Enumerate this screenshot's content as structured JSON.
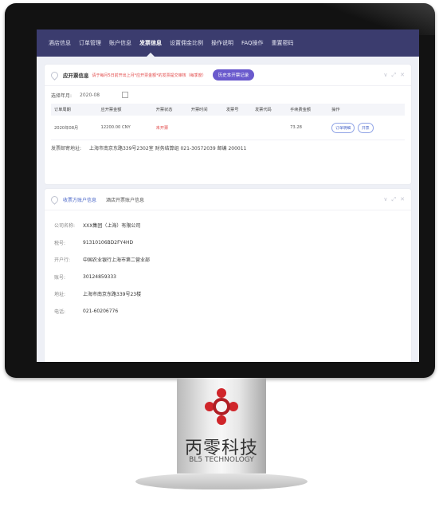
{
  "nav": {
    "items": [
      {
        "label": "酒店信息",
        "active": false
      },
      {
        "label": "订单管理",
        "active": false
      },
      {
        "label": "账户信息",
        "active": false
      },
      {
        "label": "发票信息",
        "active": true
      },
      {
        "label": "设置佣金比例",
        "active": false
      },
      {
        "label": "操作说明",
        "active": false
      },
      {
        "label": "FAQ操作",
        "active": false
      },
      {
        "label": "重置密码",
        "active": false
      }
    ]
  },
  "invoice_card": {
    "title": "应开票信息",
    "tip": "请于每月5日前开出上月*应开票金额*的发票提交审核（每季度）",
    "history_button": "历史本开票记录",
    "filter_label": "选择年月:",
    "filter_value": "2020-08",
    "columns": [
      "订单周期",
      "应开票金额",
      "开票状态",
      "开票时间",
      "发票号",
      "发票代码",
      "手续费金额",
      "操作"
    ],
    "rows": [
      {
        "period": "2020年08月",
        "amount": "12200.00 CNY",
        "status": "未开票",
        "time": "",
        "number": "",
        "code": "",
        "fee": "73.28",
        "actions": [
          "订单明细",
          "开票"
        ]
      }
    ],
    "address_label": "发票邮寄地址:",
    "address_value": "上海市南京东路339号2302室 财务结算组 021-30572039 邮编 200011"
  },
  "account_card": {
    "tabs": [
      {
        "label": "收票方账户信息",
        "active": true
      },
      {
        "label": "酒店开票账户信息",
        "active": false
      }
    ],
    "fields": [
      {
        "key": "公司名称:",
        "value": "XXX集团（上海）有限公司"
      },
      {
        "key": "税号:",
        "value": "91310106BD2FY4HD"
      },
      {
        "key": "开户行:",
        "value": "中国农业银行上海市第二营业部"
      },
      {
        "key": "账号:",
        "value": "30124859333"
      },
      {
        "key": "地址:",
        "value": "上海市南京东路339号23楼"
      },
      {
        "key": "电话:",
        "value": "021-60206776"
      }
    ]
  },
  "brand": {
    "name_cn": "丙零科技",
    "name_en": "BL5 TECHNOLOGY",
    "logo_color": "#d0252a"
  },
  "icons": [
    "pin-icon",
    "calendar-icon",
    "minimize-icon",
    "expand-icon",
    "close-icon",
    "logo-mark-icon"
  ]
}
